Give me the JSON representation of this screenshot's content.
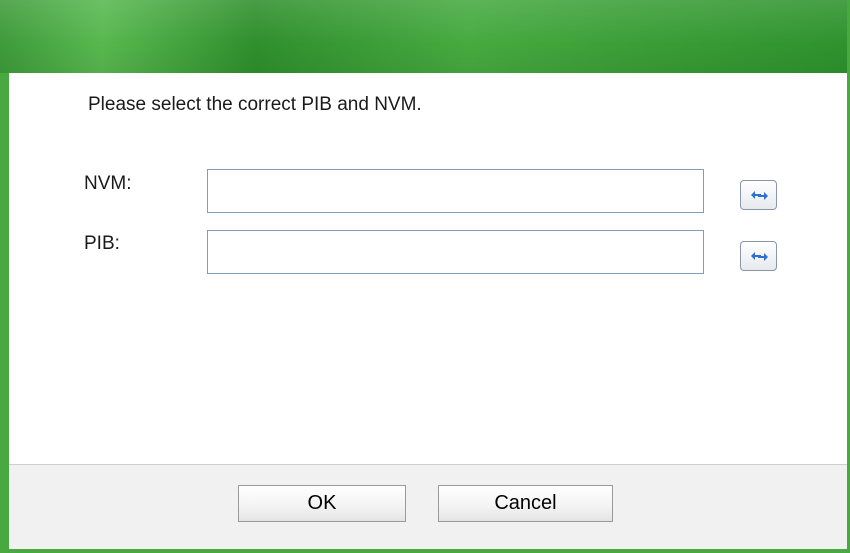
{
  "dialog": {
    "prompt": "Please select the correct PIB and NVM."
  },
  "fields": {
    "nvm": {
      "label": "NVM:",
      "value": "",
      "browse_icon": "refresh-arrows-icon"
    },
    "pib": {
      "label": "PIB:",
      "value": "",
      "browse_icon": "refresh-arrows-icon"
    }
  },
  "buttons": {
    "ok_label": "OK",
    "cancel_label": "Cancel"
  },
  "colors": {
    "accent_green": "#48a941",
    "input_border": "#7f9db9",
    "footer_bg": "#f1f1f1",
    "icon_blue": "#2f6fd0"
  }
}
